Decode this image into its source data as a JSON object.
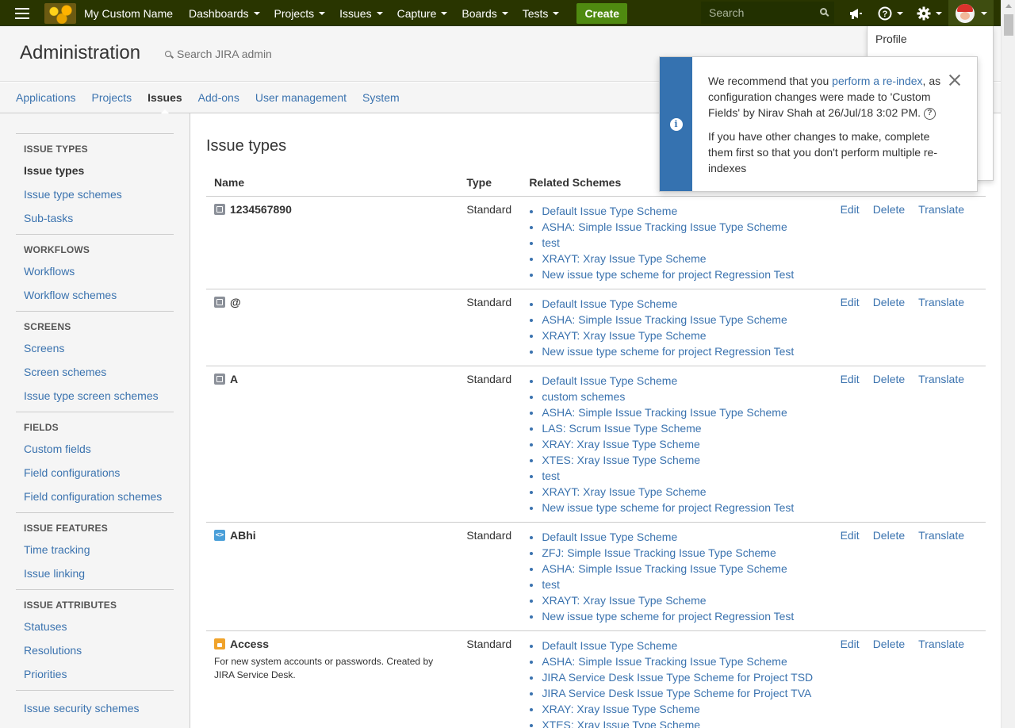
{
  "topbar": {
    "app_name": "My Custom Name",
    "menus": [
      "Dashboards",
      "Projects",
      "Issues",
      "Capture",
      "Boards",
      "Tests"
    ],
    "create_label": "Create",
    "search_placeholder": "Search",
    "icons": [
      "menu-icon",
      "megaphone-icon",
      "help-icon",
      "gear-icon",
      "avatar"
    ]
  },
  "admin": {
    "title": "Administration",
    "search_placeholder": "Search JIRA admin",
    "tabs": [
      "Applications",
      "Projects",
      "Issues",
      "Add-ons",
      "User management",
      "System"
    ],
    "active_tab": "Issues"
  },
  "sidebar": {
    "groups": [
      {
        "heading": "ISSUE TYPES",
        "items": [
          "Issue types",
          "Issue type schemes",
          "Sub-tasks"
        ]
      },
      {
        "heading": "WORKFLOWS",
        "items": [
          "Workflows",
          "Workflow schemes"
        ]
      },
      {
        "heading": "SCREENS",
        "items": [
          "Screens",
          "Screen schemes",
          "Issue type screen schemes"
        ]
      },
      {
        "heading": "FIELDS",
        "items": [
          "Custom fields",
          "Field configurations",
          "Field configuration schemes"
        ]
      },
      {
        "heading": "ISSUE FEATURES",
        "items": [
          "Time tracking",
          "Issue linking"
        ]
      },
      {
        "heading": "ISSUE ATTRIBUTES",
        "items": [
          "Statuses",
          "Resolutions",
          "Priorities"
        ]
      },
      {
        "heading": "",
        "items": [
          "Issue security schemes"
        ]
      }
    ],
    "active_item": "Issue types"
  },
  "main": {
    "heading": "Issue types",
    "columns": [
      "Name",
      "Type",
      "Related Schemes"
    ],
    "operations": [
      "Edit",
      "Delete",
      "Translate"
    ],
    "rows": [
      {
        "name": "1234567890",
        "icon": "grey",
        "description": "",
        "type": "Standard",
        "schemes": [
          "Default Issue Type Scheme",
          "ASHA: Simple Issue Tracking Issue Type Scheme",
          "test",
          "XRAYT: Xray Issue Type Scheme",
          "New issue type scheme for project Regression Test"
        ]
      },
      {
        "name": "@",
        "icon": "grey",
        "description": "",
        "type": "Standard",
        "schemes": [
          "Default Issue Type Scheme",
          "ASHA: Simple Issue Tracking Issue Type Scheme",
          "XRAYT: Xray Issue Type Scheme",
          "New issue type scheme for project Regression Test"
        ]
      },
      {
        "name": "A",
        "icon": "grey",
        "description": "",
        "type": "Standard",
        "schemes": [
          "Default Issue Type Scheme",
          "custom schemes",
          "ASHA: Simple Issue Tracking Issue Type Scheme",
          "LAS: Scrum Issue Type Scheme",
          "XRAY: Xray Issue Type Scheme",
          "XTES: Xray Issue Type Scheme",
          "test",
          "XRAYT: Xray Issue Type Scheme",
          "New issue type scheme for project Regression Test"
        ]
      },
      {
        "name": "ABhi",
        "icon": "blue",
        "description": "",
        "type": "Standard",
        "schemes": [
          "Default Issue Type Scheme",
          "ZFJ: Simple Issue Tracking Issue Type Scheme",
          "ASHA: Simple Issue Tracking Issue Type Scheme",
          "test",
          "XRAYT: Xray Issue Type Scheme",
          "New issue type scheme for project Regression Test"
        ]
      },
      {
        "name": "Access",
        "icon": "orange",
        "description": "For new system accounts or passwords. Created by JIRA Service Desk.",
        "type": "Standard",
        "schemes": [
          "Default Issue Type Scheme",
          "ASHA: Simple Issue Tracking Issue Type Scheme",
          "JIRA Service Desk Issue Type Scheme for Project TSD",
          "JIRA Service Desk Issue Type Scheme for Project TVA",
          "XRAY: Xray Issue Type Scheme",
          "XTES: Xray Issue Type Scheme"
        ]
      }
    ]
  },
  "profile_menu": {
    "first_item": "Profile"
  },
  "flag": {
    "text_before_link": "We recommend that you ",
    "link_text": "perform a re-index",
    "text_after_link": ", as configuration changes were made to 'Custom Fields' by Nirav Shah at 26/Jul/18 3:02 PM.",
    "second_paragraph": "If you have other changes to make, complete them first so that you don't perform multiple re-indexes"
  },
  "colors": {
    "topbar": "#293500",
    "create_button": "#4f8a10",
    "link": "#3b73af",
    "flag_accent": "#3572b0"
  }
}
